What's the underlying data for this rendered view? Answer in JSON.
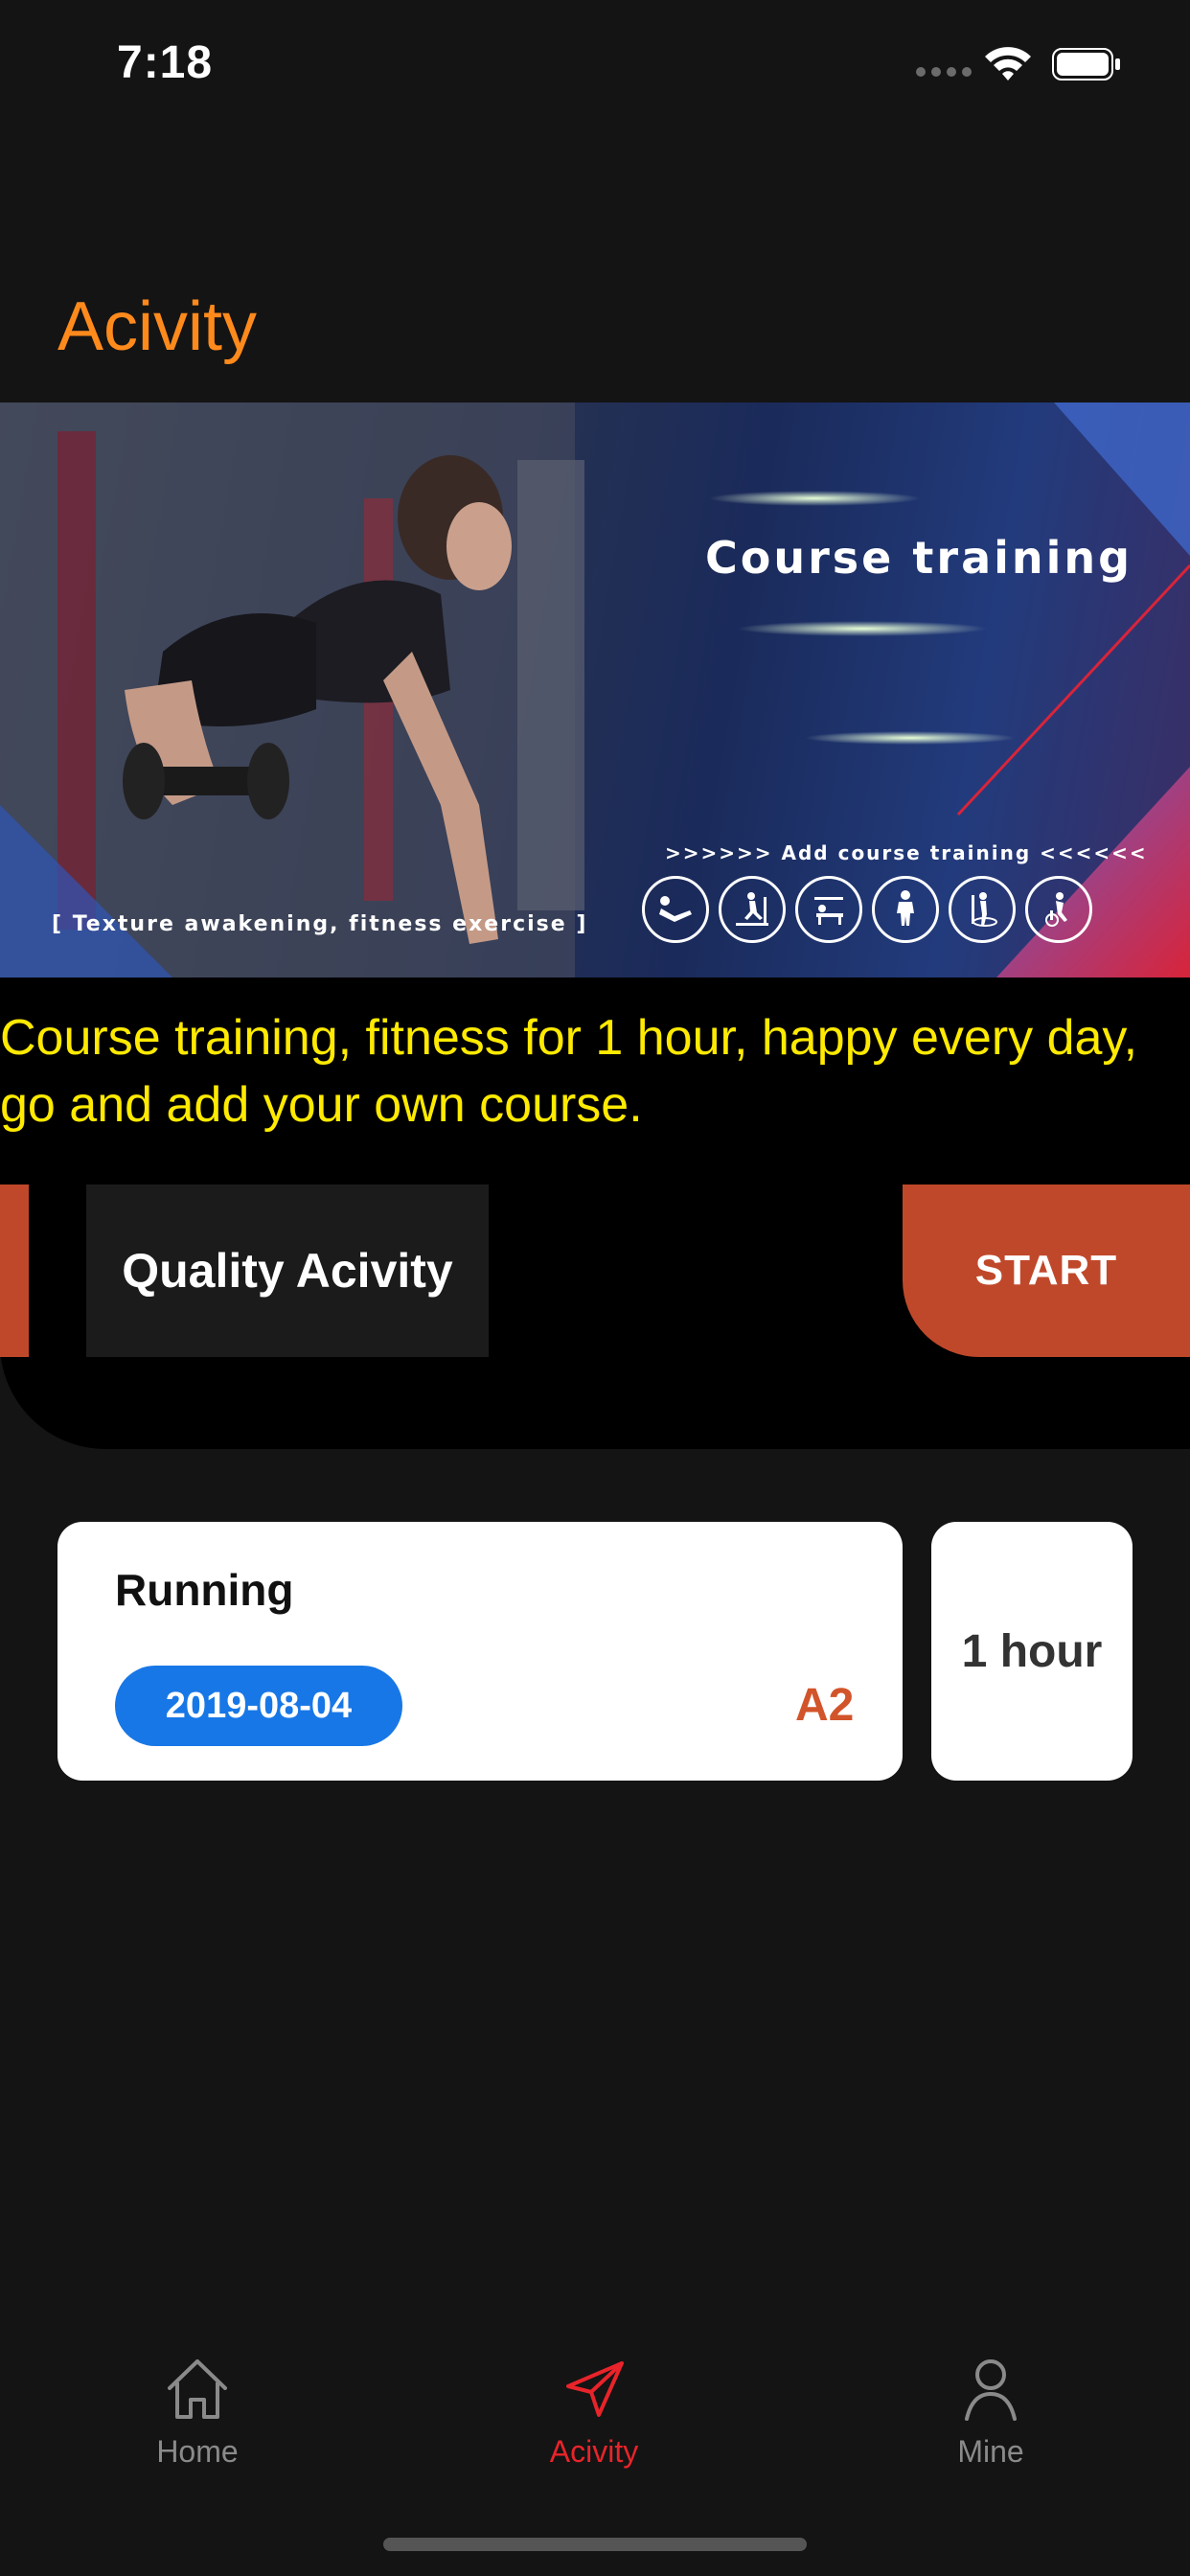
{
  "status_bar": {
    "time": "7:18"
  },
  "page": {
    "title": "Acivity"
  },
  "banner": {
    "title": "Course training",
    "subtitle": ">>>>>> Add course training <<<<<<",
    "tagline": "[ Texture awakening, fitness exercise ]",
    "icons": [
      "situp-icon",
      "treadmill-icon",
      "bench-press-icon",
      "standing-icon",
      "elliptical-icon",
      "bike-icon"
    ]
  },
  "promo": {
    "text": "Course training, fitness for 1 hour, happy every day, go and add your own course."
  },
  "quality": {
    "label": "Quality Acivity",
    "start_label": "START"
  },
  "activity_card": {
    "name": "Running",
    "date": "2019-08-04",
    "level": "A2",
    "duration": "1 hour"
  },
  "tab_bar": {
    "items": [
      {
        "label": "Home",
        "icon": "home-icon",
        "active": false
      },
      {
        "label": "Acivity",
        "icon": "navigation-arrow-icon",
        "active": true
      },
      {
        "label": "Mine",
        "icon": "person-icon",
        "active": false
      }
    ],
    "active_color": "#e8242a",
    "inactive_color": "#8a8a8a"
  },
  "colors": {
    "title_orange": "#ff8a1c",
    "accent_red": "#c0482a",
    "promo_yellow": "#ffea00",
    "date_blue": "#1877e6"
  }
}
